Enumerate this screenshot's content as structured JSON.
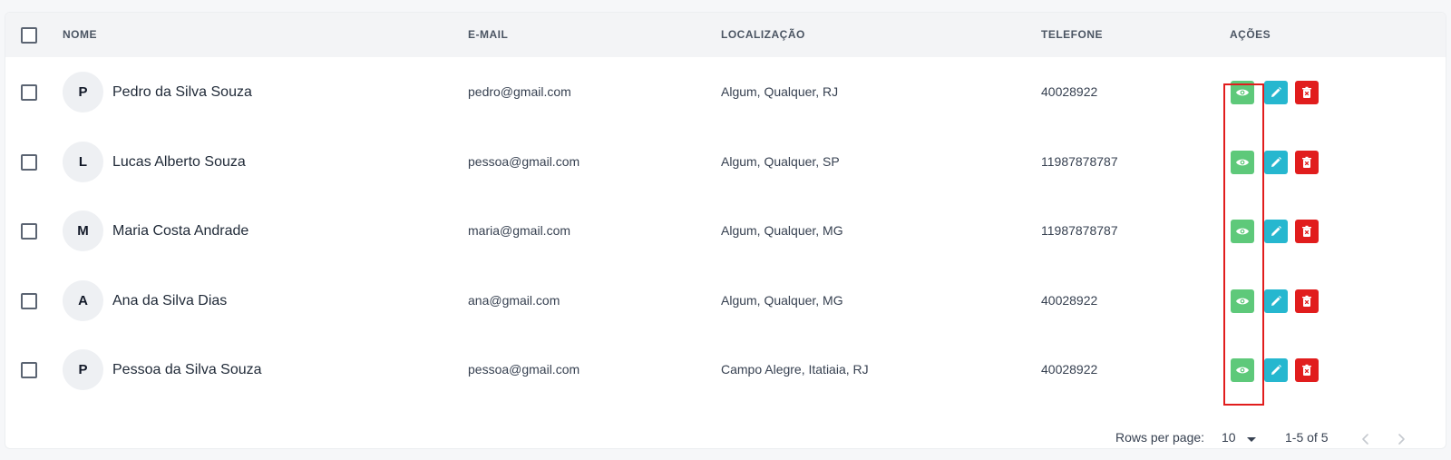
{
  "table": {
    "headers": {
      "name": "NOME",
      "email": "E-MAIL",
      "location": "LOCALIZAÇÃO",
      "phone": "TELEFONE",
      "actions": "AÇÕES"
    },
    "rows": [
      {
        "initial": "P",
        "name": "Pedro da Silva Souza",
        "email": "pedro@gmail.com",
        "location": "Algum, Qualquer, RJ",
        "phone": "40028922"
      },
      {
        "initial": "L",
        "name": "Lucas Alberto Souza",
        "email": "pessoa@gmail.com",
        "location": "Algum, Qualquer, SP",
        "phone": "11987878787"
      },
      {
        "initial": "M",
        "name": "Maria Costa Andrade",
        "email": "maria@gmail.com",
        "location": "Algum, Qualquer, MG",
        "phone": "11987878787"
      },
      {
        "initial": "A",
        "name": "Ana da Silva Dias",
        "email": "ana@gmail.com",
        "location": "Algum, Qualquer, MG",
        "phone": "40028922"
      },
      {
        "initial": "P",
        "name": "Pessoa da Silva Souza",
        "email": "pessoa@gmail.com",
        "location": "Campo Alegre, Itatiaia, RJ",
        "phone": "40028922"
      }
    ],
    "actions": {
      "view_icon": "eye-icon",
      "edit_icon": "pencil-icon",
      "delete_icon": "trash-icon"
    }
  },
  "pagination": {
    "rows_per_page_label": "Rows per page:",
    "rows_per_page_value": "10",
    "range": "1-5 of 5",
    "prev_icon": "chevron-left-icon",
    "next_icon": "chevron-right-icon"
  },
  "colors": {
    "view": "#5ec97a",
    "edit": "#26b7cf",
    "delete": "#e11d1d",
    "highlight": "#e11d1d"
  }
}
